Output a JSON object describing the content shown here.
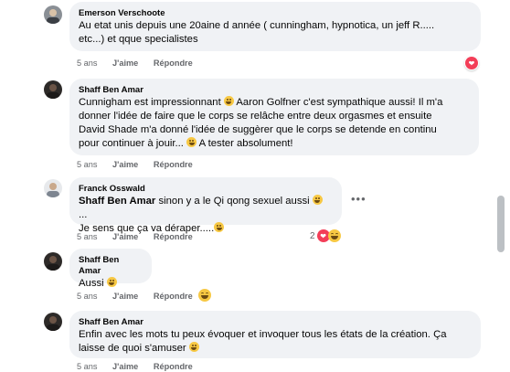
{
  "comments": [
    {
      "author": "Emerson Verschoote",
      "text_lines": [
        "Au etat unis depuis une 20aine d année ( cunningham, hypnotica, un jeff R.....",
        "etc...) et qque specialistes"
      ],
      "time": "5 ans",
      "like": "J'aime",
      "reply": "Répondre"
    },
    {
      "author": "Shaff Ben Amar",
      "text_lines": [
        "Cunnigham est impressionnant",
        "Aaron Golfner c'est sympathique aussi! Il m'a",
        "donner l'idée de faire que le corps se relâche entre deux orgasmes et ensuite",
        "David Shade m'a donné l'idée de suggèrer que le corps se detende en continu",
        "pour continuer à jouir...",
        "A tester absolument!"
      ],
      "time": "5 ans",
      "like": "J'aime",
      "reply": "Répondre"
    },
    {
      "author": "Franck Osswald",
      "mention": "Shaff Ben Amar",
      "text_lines": [
        "sinon y a le Qi qong sexuel aussi",
        "...",
        "Je sens que ça va déraper....."
      ],
      "time": "5 ans",
      "like": "J'aime",
      "reply": "Répondre",
      "reaction_count": "2"
    },
    {
      "author": "Shaff Ben Amar",
      "text_lines": [
        "Aussi"
      ],
      "time": "5 ans",
      "like": "J'aime",
      "reply": "Répondre"
    },
    {
      "author": "Shaff Ben Amar",
      "text_lines": [
        "Enfin avec les mots tu peux évoquer et invoquer tous les états de la création. Ça",
        "laisse de quoi s'amuser"
      ],
      "time": "5 ans",
      "like": "J'aime",
      "reply": "Répondre"
    }
  ],
  "colors": {
    "bubble": "#f0f2f5",
    "heart": "#f33e58",
    "meta": "#65676b"
  }
}
